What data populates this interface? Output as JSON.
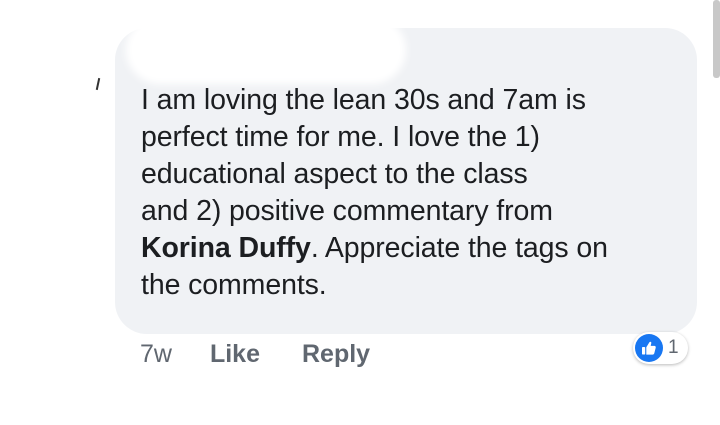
{
  "comment": {
    "lines": [
      "I am loving the lean 30s and 7am is",
      "perfect time for me. I love the 1)",
      "educational aspect to the class",
      "and 2) positive commentary from"
    ],
    "mention": "Korina Duffy",
    "after_mention": ". Appreciate the tags on",
    "last_line": "the comments."
  },
  "actions": {
    "timestamp": "7w",
    "like_label": "Like",
    "reply_label": "Reply"
  },
  "reactions": {
    "icon": "thumbs-up-icon",
    "count": "1",
    "color": "#1877f2"
  },
  "colors": {
    "bubble": "#f0f2f5",
    "text": "#1c1e21",
    "meta": "#606770"
  }
}
